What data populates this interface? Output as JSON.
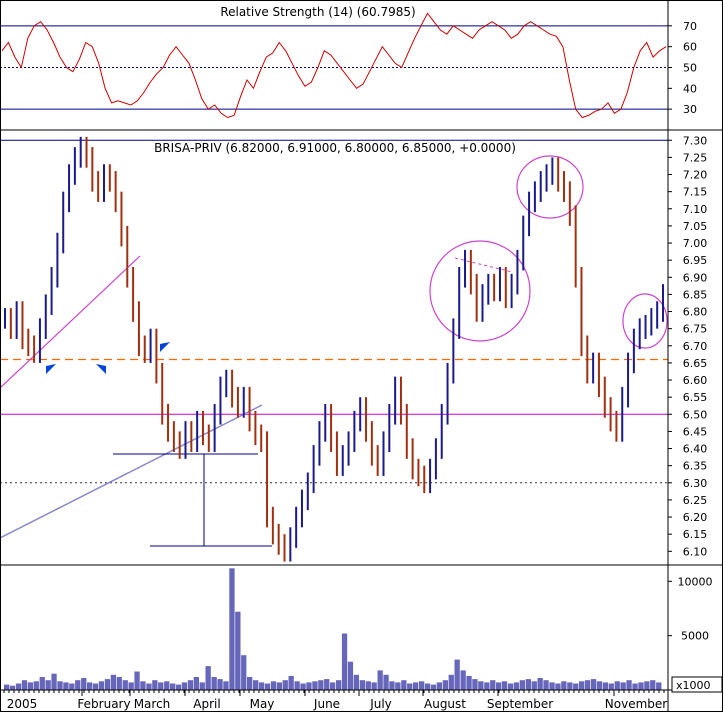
{
  "chart_data": [
    {
      "panel": "rsi",
      "type": "line",
      "title": "Relative Strength (14) (60.7985)",
      "ylim": [
        20,
        80
      ],
      "y_ticks": [
        30,
        40,
        50,
        60,
        70
      ],
      "reference_lines": [
        30,
        50,
        70
      ],
      "series": [
        {
          "color": "#cc0000",
          "values": [
            58,
            62,
            55,
            50,
            64,
            70,
            72,
            68,
            62,
            55,
            50,
            48,
            54,
            62,
            60,
            52,
            40,
            33,
            34,
            33,
            32,
            34,
            38,
            43,
            47,
            50,
            56,
            60,
            56,
            52,
            44,
            35,
            30,
            32,
            28,
            26,
            27,
            36,
            44,
            40,
            48,
            55,
            57,
            62,
            58,
            52,
            46,
            41,
            43,
            50,
            58,
            56,
            52,
            48,
            44,
            40,
            42,
            48,
            54,
            60,
            56,
            52,
            50,
            57,
            64,
            70,
            76,
            72,
            68,
            66,
            70,
            68,
            66,
            64,
            68,
            70,
            72,
            70,
            68,
            64,
            66,
            70,
            72,
            70,
            68,
            66,
            65,
            60,
            44,
            30,
            26,
            27,
            29,
            30,
            33,
            28,
            30,
            38,
            50,
            58,
            62,
            55,
            58,
            60
          ]
        }
      ]
    },
    {
      "panel": "price",
      "type": "ohlc",
      "title": "BRISA-PRIV (6.82000, 6.91000, 6.80000, 6.85000, +0.0000)",
      "ylim": [
        6.06,
        7.33
      ],
      "y_ticks": [
        6.1,
        6.15,
        6.2,
        6.25,
        6.3,
        6.35,
        6.4,
        6.45,
        6.5,
        6.55,
        6.6,
        6.65,
        6.7,
        6.75,
        6.8,
        6.85,
        6.9,
        6.95,
        7.0,
        7.05,
        7.1,
        7.15,
        7.2,
        7.25,
        7.3
      ],
      "x_categories": [
        "2005",
        "February",
        "March",
        "April",
        "May",
        "June",
        "July",
        "August",
        "September",
        "November"
      ],
      "close": [
        6.78,
        6.75,
        6.8,
        6.72,
        6.7,
        6.68,
        6.75,
        6.82,
        6.9,
        7.0,
        7.12,
        7.2,
        7.25,
        7.28,
        7.25,
        7.18,
        7.15,
        7.2,
        7.18,
        7.12,
        7.02,
        6.9,
        6.8,
        6.7,
        6.68,
        6.72,
        6.62,
        6.5,
        6.45,
        6.42,
        6.4,
        6.45,
        6.42,
        6.48,
        6.44,
        6.42,
        6.5,
        6.58,
        6.6,
        6.55,
        6.52,
        6.55,
        6.48,
        6.44,
        6.42,
        6.2,
        6.15,
        6.12,
        6.1,
        6.14,
        6.2,
        6.25,
        6.3,
        6.38,
        6.45,
        6.5,
        6.42,
        6.35,
        6.38,
        6.42,
        6.48,
        6.52,
        6.45,
        6.38,
        6.35,
        6.42,
        6.5,
        6.58,
        6.5,
        6.4,
        6.34,
        6.32,
        6.3,
        6.34,
        6.4,
        6.5,
        6.62,
        6.75,
        6.9,
        6.95,
        6.88,
        6.8,
        6.85,
        6.88,
        6.86,
        6.9,
        6.84,
        6.88,
        6.95,
        7.05,
        7.12,
        7.15,
        7.18,
        7.2,
        7.22,
        7.18,
        7.15,
        7.08,
        6.9,
        6.7,
        6.62,
        6.65,
        6.58,
        6.52,
        6.48,
        6.45,
        6.55,
        6.65,
        6.72,
        6.75,
        6.76,
        6.78,
        6.8,
        6.85
      ],
      "reference_lines": [
        {
          "value": 6.66,
          "style": "dashed",
          "color": "#ff6600"
        },
        {
          "value": 6.5,
          "style": "solid",
          "color": "#cc00cc"
        },
        {
          "value": 6.3,
          "style": "dotted",
          "color": "#333333"
        },
        {
          "value": 7.3,
          "style": "solid",
          "color": "#000080"
        }
      ]
    },
    {
      "panel": "volume",
      "type": "bar",
      "ylim": [
        0,
        11500
      ],
      "y_ticks": [
        5000,
        10000
      ],
      "unit_label": "x1000",
      "values": [
        500,
        400,
        600,
        900,
        700,
        800,
        1200,
        900,
        1500,
        800,
        700,
        600,
        900,
        1100,
        700,
        600,
        800,
        1000,
        1400,
        1200,
        900,
        700,
        1700,
        800,
        600,
        900,
        700,
        800,
        600,
        500,
        700,
        900,
        1200,
        700,
        2200,
        1200,
        1000,
        800,
        11200,
        7200,
        3200,
        1200,
        900,
        700,
        600,
        800,
        700,
        900,
        1300,
        800,
        600,
        700,
        800,
        900,
        1000,
        700,
        900,
        5200,
        2600,
        1400,
        900,
        800,
        700,
        1800,
        1400,
        800,
        700,
        900,
        600,
        700,
        800,
        600,
        500,
        700,
        900,
        1400,
        2800,
        1800,
        1300,
        1000,
        800,
        700,
        900,
        700,
        800,
        600,
        700,
        900,
        1000,
        800,
        1100,
        900,
        700,
        600,
        800,
        700,
        600,
        800,
        900,
        1000,
        800,
        700,
        600,
        800,
        700,
        900,
        600,
        700,
        800,
        900,
        700
      ]
    }
  ]
}
